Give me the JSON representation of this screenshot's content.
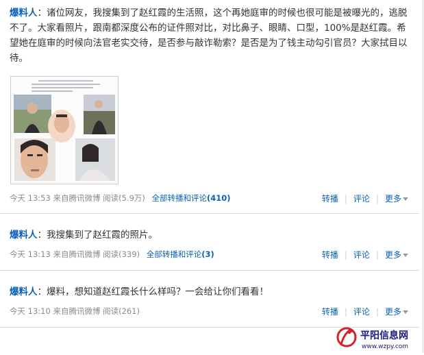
{
  "posts": [
    {
      "author": "爆料人",
      "sep": "：",
      "text": "诸位网友，我搜集到了赵红霞的生活照，这个再她庭审的时候也很可能是被曝光的，逃脱不了。大家看照片，跟南都深度公布的证件照对比，对比鼻子、眼睛、口型，100%是赵红霞。希望她在庭审的时候向法官老实交待，是否参与敲诈勒索？是否是为了钱主动勾引官员？大家拭目以待。",
      "time": "今天 13:53",
      "source": "来自腾讯微博",
      "reads": "阅读(5.9万)",
      "all_label": "全部转播和评论",
      "all_count": "(410)",
      "actions": {
        "forward": "转播",
        "comment": "评论",
        "more": "更多"
      }
    },
    {
      "author": "爆料人",
      "sep": "：",
      "text": "我搜集到了赵红霞的照片。",
      "time": "今天 13:13",
      "source": "来自腾讯微博",
      "reads": "阅读(339)",
      "all_label": "全部转播和评论",
      "all_count": "(3)",
      "actions": {
        "forward": "转播",
        "comment": "评论",
        "more": "更多"
      }
    },
    {
      "author": "爆料人",
      "sep": "：",
      "text": "爆料，想知道赵红霞长什么样吗？一会给让你们看看！",
      "time": "今天 13:10",
      "source": "来自腾讯微博",
      "reads": "阅读(261)",
      "actions": {
        "forward": "转播",
        "comment": "评论",
        "more": "更多"
      }
    }
  ],
  "watermark": {
    "name": "平阳信息网",
    "url": "www.wzpy.com"
  }
}
